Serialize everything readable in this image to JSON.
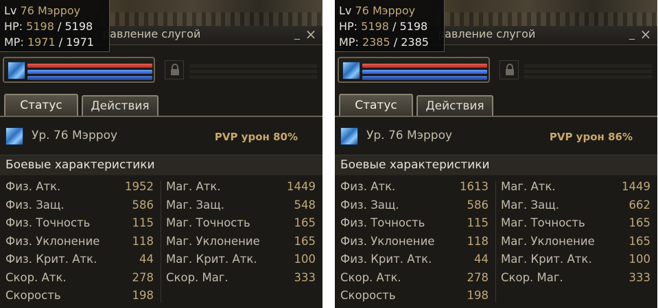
{
  "panels": [
    {
      "tooltip": {
        "lv_label": "Lv",
        "level": "76",
        "name": "Мэрроу",
        "hp_label": "HP:",
        "hp_current": "5198",
        "hp_max": "5198",
        "mp_label": "MP:",
        "mp_current": "1971",
        "mp_max": "1971",
        "sep": "/"
      },
      "title": "равление слугой",
      "tabs": {
        "status": "Статус",
        "actions": "Действия"
      },
      "name_line": "Ур. 76 Мэрроу",
      "pvp": "PVP урон 80%",
      "section_title": "Боевые характеристики",
      "stats_left": [
        {
          "label": "Физ. Атк.",
          "value": "1952"
        },
        {
          "label": "Физ. Защ.",
          "value": "586"
        },
        {
          "label": "Физ. Точность",
          "value": "115"
        },
        {
          "label": "Физ. Уклонение",
          "value": "118"
        },
        {
          "label": "Физ. Крит. Атк.",
          "value": "44"
        },
        {
          "label": "Скор. Атк.",
          "value": "278"
        },
        {
          "label": "Скорость",
          "value": "198"
        }
      ],
      "stats_right": [
        {
          "label": "Маг. Атк.",
          "value": "1449"
        },
        {
          "label": "Маг. Защ.",
          "value": "548"
        },
        {
          "label": "Маг. Точность",
          "value": "165"
        },
        {
          "label": "Маг. Уклонение",
          "value": "165"
        },
        {
          "label": "Маг. Крит. Атк.",
          "value": "100"
        },
        {
          "label": "Скор. Маг.",
          "value": "333"
        }
      ]
    },
    {
      "tooltip": {
        "lv_label": "Lv",
        "level": "76",
        "name": "Мэрроу",
        "hp_label": "HP:",
        "hp_current": "5198",
        "hp_max": "5198",
        "mp_label": "MP:",
        "mp_current": "2385",
        "mp_max": "2385",
        "sep": "/"
      },
      "title": "равление слугой",
      "tabs": {
        "status": "Статус",
        "actions": "Действия"
      },
      "name_line": "Ур. 76 Мэрроу",
      "pvp": "PVP урон 86%",
      "section_title": "Боевые характеристики",
      "stats_left": [
        {
          "label": "Физ. Атк.",
          "value": "1613"
        },
        {
          "label": "Физ. Защ.",
          "value": "586"
        },
        {
          "label": "Физ. Точность",
          "value": "115"
        },
        {
          "label": "Физ. Уклонение",
          "value": "118"
        },
        {
          "label": "Физ. Крит. Атк.",
          "value": "44"
        },
        {
          "label": "Скор. Атк.",
          "value": "278"
        },
        {
          "label": "Скорость",
          "value": "198"
        }
      ],
      "stats_right": [
        {
          "label": "Маг. Атк.",
          "value": "1449"
        },
        {
          "label": "Маг. Защ.",
          "value": "662"
        },
        {
          "label": "Маг. Точность",
          "value": "165"
        },
        {
          "label": "Маг. Уклонение",
          "value": "165"
        },
        {
          "label": "Маг. Крит. Атк.",
          "value": "100"
        },
        {
          "label": "Скор. Маг.",
          "value": "333"
        }
      ]
    }
  ],
  "window_buttons": {
    "minimize": "_",
    "close": "×"
  },
  "colors": {
    "stat_value": "#c2a878",
    "pvp": "#c9a86a",
    "hp_bar": "#d0433a",
    "mp_bar": "#3d6ee0"
  }
}
